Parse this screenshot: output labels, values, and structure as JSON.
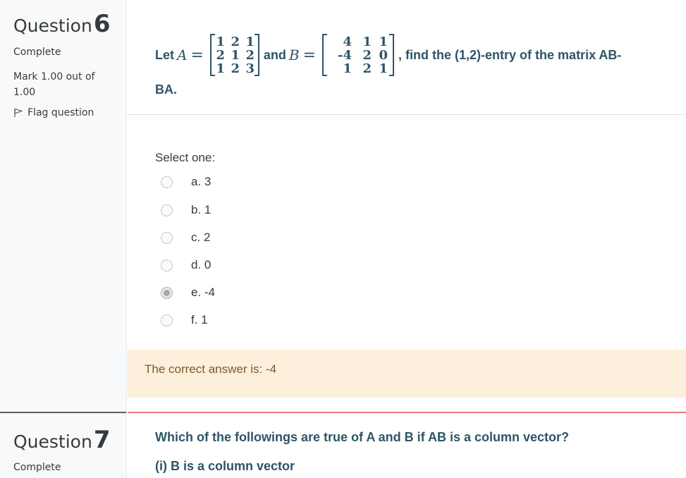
{
  "question6": {
    "title": "Question",
    "number": "6",
    "state": "Complete",
    "grade": "Mark 1.00 out of 1.00",
    "flag_label": "Flag question",
    "text": {
      "let": "Let",
      "var_a": "A",
      "eq": "=",
      "and": "and",
      "var_b": "B",
      "suffix": ", find the (1,2)-entry of the matrix AB-",
      "line2": "BA."
    },
    "matrix_a": [
      [
        "1",
        "2",
        "1"
      ],
      [
        "2",
        "1",
        "2"
      ],
      [
        "1",
        "2",
        "3"
      ]
    ],
    "matrix_b": [
      [
        "4",
        "1",
        "1"
      ],
      [
        "-4",
        "2",
        "0"
      ],
      [
        "1",
        "2",
        "1"
      ]
    ],
    "prompt": "Select one:",
    "options": [
      {
        "label": "a. 3",
        "checked": false
      },
      {
        "label": "b. 1",
        "checked": false
      },
      {
        "label": "c. 2",
        "checked": false
      },
      {
        "label": "d. 0",
        "checked": false
      },
      {
        "label": "e. -4",
        "checked": true
      },
      {
        "label": "f. 1",
        "checked": false
      }
    ],
    "feedback": "The correct answer is: -4"
  },
  "question7": {
    "title": "Question",
    "number": "7",
    "state": "Complete",
    "text_line1": "Which of the followings are true of A and B if AB is a column vector?",
    "text_line2": "(i) B is a column vector"
  },
  "colors": {
    "question_text": "#2e5566",
    "feedback_bg": "#fcefdc",
    "feedback_text": "#7d5a29",
    "divider_accent": "#e97b83"
  }
}
